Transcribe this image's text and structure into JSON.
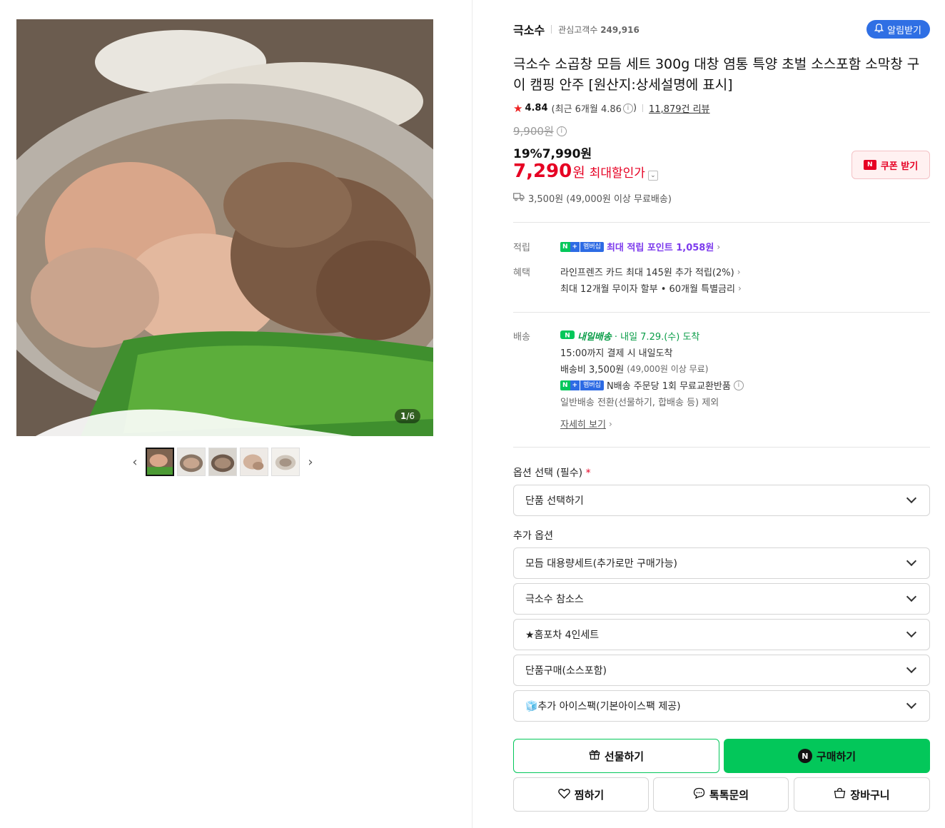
{
  "gallery": {
    "counter_current": "1",
    "counter_total": "/6",
    "thumbnails": [
      "thumb-1",
      "thumb-2",
      "thumb-3",
      "thumb-4",
      "thumb-5"
    ],
    "prev_icon": "chevron-left-icon",
    "next_icon": "chevron-right-icon"
  },
  "store": {
    "name": "극소수",
    "interest_label": "관심고객수",
    "interest_count": "249,916",
    "alarm_label": "알림받기"
  },
  "product": {
    "title": "극소수 소곱창 모듬 세트 300g 대창 염통 특양 초벌 소스포함 소막창 구이 캠핑 안주 [원산지:상세설명에 표시]",
    "rating": "4.84",
    "rating_recent": "(최근 6개월 4.86",
    "review_count": "11,879건 리뷰"
  },
  "price": {
    "original": "9,900원",
    "sale": "19%7,990원",
    "max_price": "7,290",
    "max_unit": "원",
    "max_label": "최대할인가",
    "coupon_label": "쿠폰 받기",
    "shipping": "3,500원 (49,000원 이상 무료배송)"
  },
  "benefits": {
    "point_label": "적립",
    "point_text": "최대 적립 포인트 1,058원",
    "benefit_label": "혜택",
    "benefit_line1": "라인프렌즈 카드 최대 145원 추가 적립(2%)",
    "benefit_line2": "최대 12개월 무이자 할부 • 60개월 특별금리",
    "membership": "멤버십"
  },
  "delivery": {
    "label": "배송",
    "tag": "내일배송",
    "arrival": "· 내일 7.29.(수) 도착",
    "line1": "15:00까지 결제 시 내일도착",
    "line2_a": "배송비 3,500원",
    "line2_b": "(49,000원 이상 무료)",
    "line3": "N배송 주문당 1회 무료교환반품",
    "line4": "일반배송 전환(선물하기, 합배송 등) 제외",
    "detail_link": "자세히 보기"
  },
  "options": {
    "required_label": "옵션 선택 (필수)",
    "required_mark": "*",
    "required_select": "단품 선택하기",
    "extra_label": "추가 옵션",
    "extra": [
      "모듬 대용량세트(추가로만 구매가능)",
      "극소수 참소스",
      "★홈포차 4인세트",
      "단품구매(소스포함)",
      "🧊추가 아이스팩(기본아이스팩 제공)"
    ]
  },
  "actions": {
    "gift": "선물하기",
    "buy": "구매하기",
    "wish": "찜하기",
    "talk": "톡톡문의",
    "cart": "장바구니"
  },
  "colors": {
    "accent_green": "#03c75a",
    "price_red": "#e60023",
    "alarm_blue": "#2f6fe4"
  }
}
